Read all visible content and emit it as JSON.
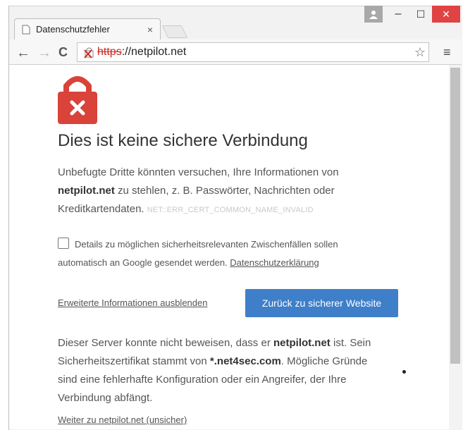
{
  "tab": {
    "title": "Datenschutzfehler",
    "close": "×"
  },
  "toolbar": {
    "back": "←",
    "forward": "→",
    "reload": "C",
    "url_scheme": "https",
    "url_rest": "://netpilot.net",
    "star": "☆",
    "menu": "≡"
  },
  "window": {
    "minimize": "–",
    "maximize": "☐",
    "close": "✕"
  },
  "page": {
    "heading": "Dies ist keine sichere Verbindung",
    "intro_1": "Unbefugte Dritte könnten versuchen, Ihre Informationen von ",
    "intro_host": "netpilot.net",
    "intro_2": " zu stehlen, z. B. Passwörter, Nachrichten oder Kreditkartendaten.",
    "error_code": "NET::ERR_CERT_COMMON_NAME_INVALID",
    "checkbox_text": "Details zu möglichen sicherheitsrelevanten Zwischenfällen sollen automatisch an Google gesendet werden.",
    "privacy_link": "Datenschutzerklärung",
    "advanced_link": "Erweiterte Informationen ausblenden",
    "back_button": "Zurück zu sicherer Website",
    "detail_1": "Dieser Server konnte nicht beweisen, dass er ",
    "detail_host": "netpilot.net",
    "detail_2": " ist. Sein Sicherheitszertifikat stammt von ",
    "detail_cert": "*.net4sec.com",
    "detail_3": ". Mögliche Gründe sind eine fehlerhafte Konfiguration oder ein Angreifer, der Ihre Verbindung abfängt.",
    "proceed_link": "Weiter zu netpilot.net (unsicher)"
  },
  "colors": {
    "danger": "#d9433a",
    "button": "#3f7fc9",
    "close_button": "#e04343"
  }
}
